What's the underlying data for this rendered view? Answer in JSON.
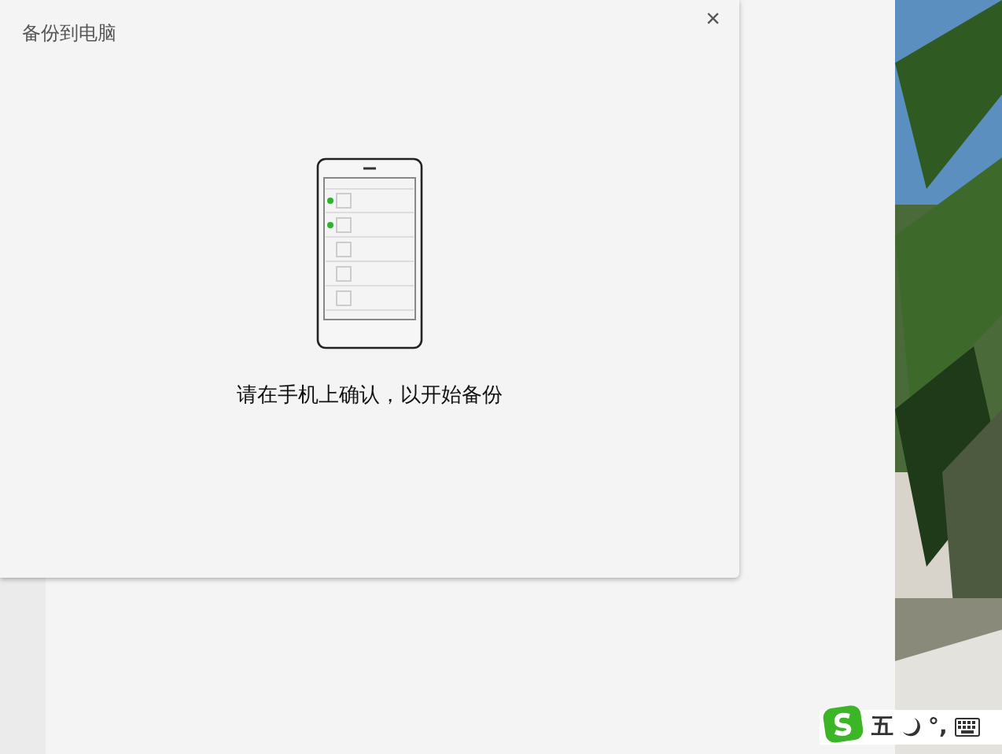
{
  "dialog": {
    "title": "备份到电脑",
    "close": "×",
    "message": "请在手机上确认，以开始备份",
    "phone_rows": [
      {
        "checked": true
      },
      {
        "checked": true
      },
      {
        "checked": false
      },
      {
        "checked": false
      },
      {
        "checked": false
      }
    ]
  },
  "ime_bar": {
    "mode": "五",
    "punctuation": "°,"
  }
}
